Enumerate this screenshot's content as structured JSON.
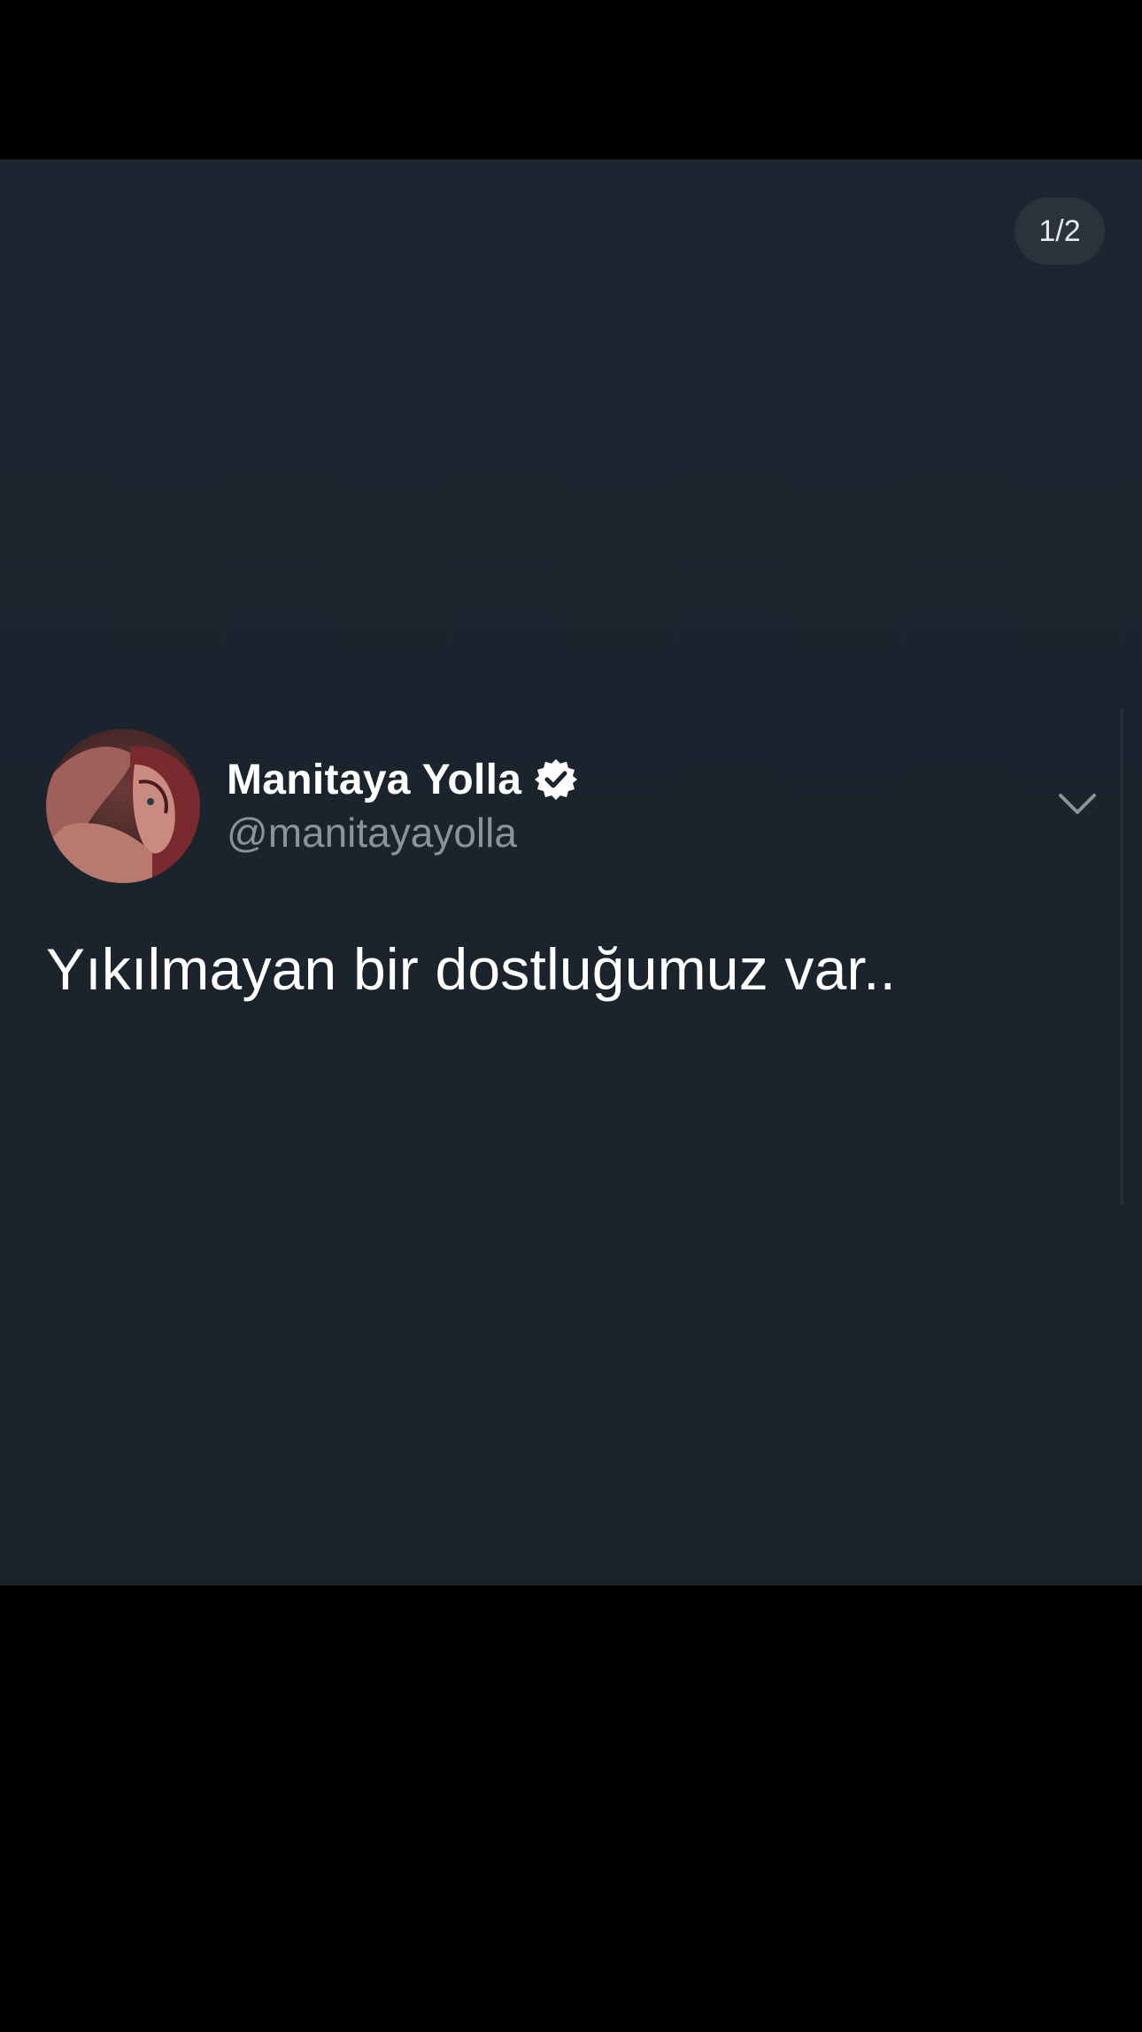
{
  "viewer": {
    "page_counter": "1/2"
  },
  "tweet": {
    "display_name": "Manitaya Yolla",
    "verified": true,
    "handle": "@manitayayolla",
    "text": "Yıkılmayan bir dostluğumuz var..",
    "menu_icon": "chevron-down-icon",
    "avatar_icon": "avatar"
  },
  "colors": {
    "background": "#1b232c",
    "letterbox": "#000000",
    "text_primary": "#ffffff",
    "text_secondary": "#8a939c",
    "counter_bg": "#2a323c"
  }
}
